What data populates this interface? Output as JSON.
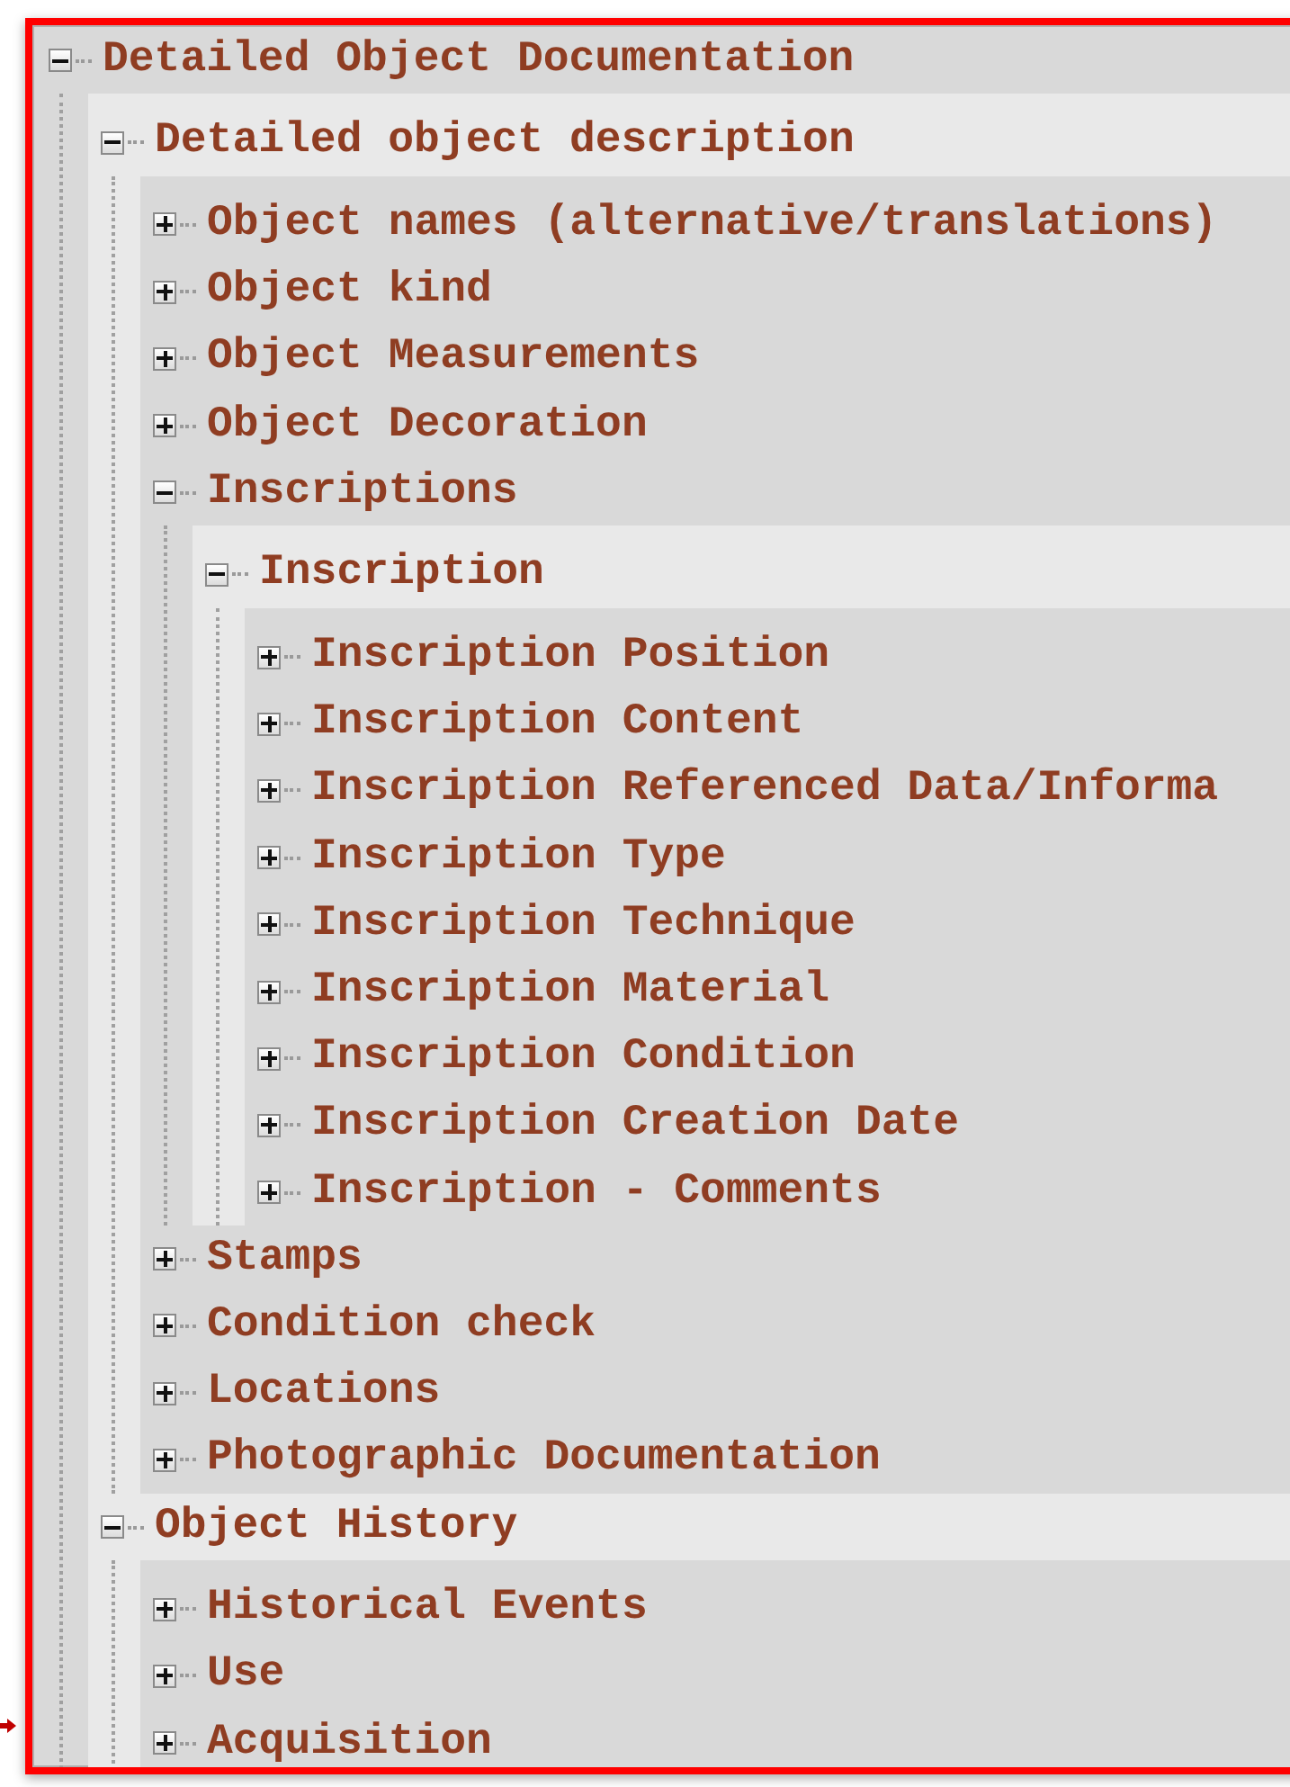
{
  "tree": [
    {
      "label": "Detailed Object Documentation",
      "expanded": true,
      "children": [
        {
          "label": "Detailed object description",
          "expanded": true,
          "children": [
            {
              "label": "Object names (alternative/translations)",
              "expanded": false
            },
            {
              "label": "Object kind",
              "expanded": false
            },
            {
              "label": "Object Measurements",
              "expanded": false
            },
            {
              "label": "Object Decoration",
              "expanded": false
            },
            {
              "label": "Inscriptions",
              "expanded": true,
              "children": [
                {
                  "label": "Inscription",
                  "expanded": true,
                  "children": [
                    {
                      "label": "Inscription Position",
                      "expanded": false
                    },
                    {
                      "label": "Inscription Content",
                      "expanded": false
                    },
                    {
                      "label": "Inscription Referenced Data/Informa",
                      "expanded": false
                    },
                    {
                      "label": "Inscription Type",
                      "expanded": false
                    },
                    {
                      "label": "Inscription Technique",
                      "expanded": false
                    },
                    {
                      "label": "Inscription Material",
                      "expanded": false
                    },
                    {
                      "label": "Inscription Condition",
                      "expanded": false
                    },
                    {
                      "label": "Inscription Creation Date",
                      "expanded": false
                    },
                    {
                      "label": "Inscription - Comments",
                      "expanded": false
                    }
                  ]
                }
              ]
            },
            {
              "label": "Stamps",
              "expanded": false
            },
            {
              "label": "Condition check",
              "expanded": false
            },
            {
              "label": "Locations",
              "expanded": false
            },
            {
              "label": "Photographic Documentation",
              "expanded": false
            }
          ]
        },
        {
          "label": "Object History",
          "expanded": true,
          "children": [
            {
              "label": "Historical Events",
              "expanded": false
            },
            {
              "label": "Use",
              "expanded": false
            },
            {
              "label": "Acquisition",
              "expanded": false
            }
          ]
        }
      ]
    }
  ]
}
